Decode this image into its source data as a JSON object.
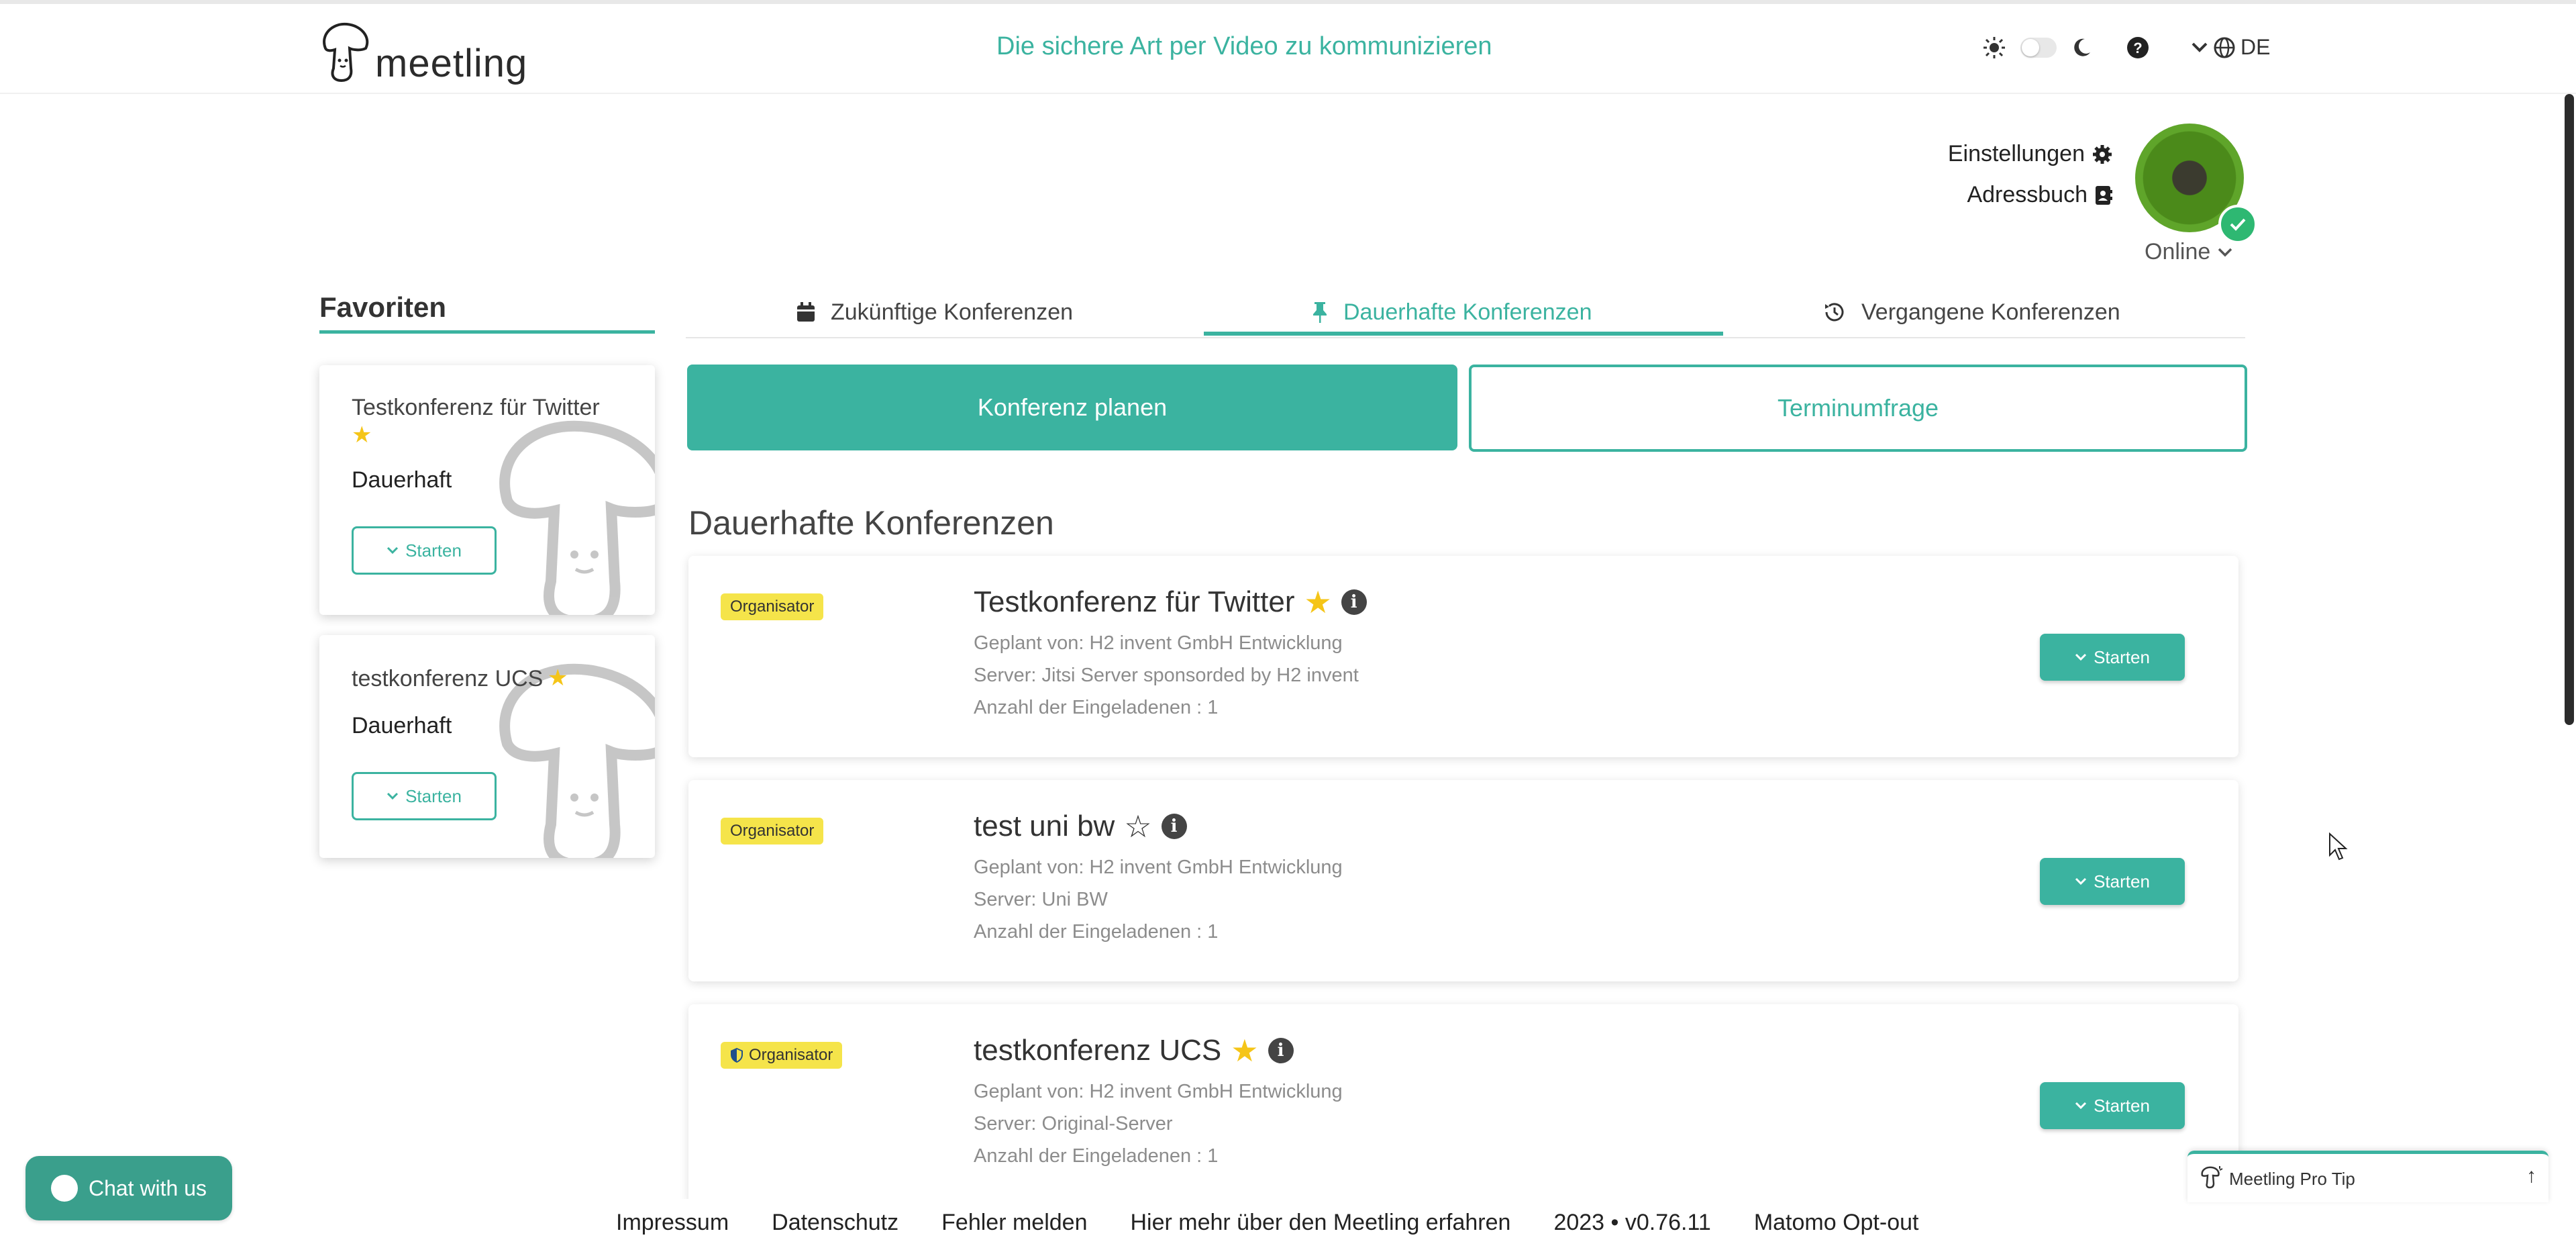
{
  "header": {
    "logo_text": "meetling",
    "tagline": "Die sichere Art per Video zu kommunizieren",
    "language": "DE"
  },
  "profile": {
    "settings_label": "Einstellungen",
    "addressbook_label": "Adressbuch",
    "status": "Online"
  },
  "favorites": {
    "title": "Favoriten",
    "items": [
      {
        "name": "Testkonferenz für Twitter",
        "type": "Dauerhaft",
        "start_label": "Starten"
      },
      {
        "name": "testkonferenz UCS",
        "type": "Dauerhaft",
        "start_label": "Starten"
      }
    ]
  },
  "tabs": [
    {
      "label": "Zukünftige Konferenzen",
      "icon": "calendar-icon"
    },
    {
      "label": "Dauerhafte Konferenzen",
      "icon": "pin-icon",
      "active": true
    },
    {
      "label": "Vergangene Konferenzen",
      "icon": "history-icon"
    }
  ],
  "actions": {
    "plan_label": "Konferenz planen",
    "poll_label": "Terminumfrage"
  },
  "section_title": "Dauerhafte Konferenzen",
  "conferences": [
    {
      "badge": "Organisator",
      "title": "Testkonferenz für Twitter",
      "starred": true,
      "planned_by": "Geplant von: H2 invent GmbH Entwicklung",
      "server": "Server: Jitsi Server sponsorded by H2 invent",
      "invited": "Anzahl der Eingeladenen : 1",
      "start_label": "Starten"
    },
    {
      "badge": "Organisator",
      "title": "test uni bw",
      "starred": false,
      "planned_by": "Geplant von: H2 invent GmbH Entwicklung",
      "server": "Server: Uni BW",
      "invited": "Anzahl der Eingeladenen : 1",
      "start_label": "Starten"
    },
    {
      "badge": "Organisator",
      "badge_icon": "shield-icon",
      "title": "testkonferenz UCS",
      "starred": true,
      "planned_by": "Geplant von: H2 invent GmbH Entwicklung",
      "server": "Server: Original-Server",
      "invited": "Anzahl der Eingeladenen : 1",
      "start_label": "Starten"
    }
  ],
  "footer": {
    "links": [
      "Impressum",
      "Datenschutz",
      "Fehler melden",
      "Hier mehr über den Meetling erfahren",
      "2023 • v0.76.11",
      "Matomo Opt-out"
    ]
  },
  "chat_label": "Chat with us",
  "protip_label": "Meetling Pro Tip",
  "colors": {
    "accent": "#3bb3a0",
    "badge": "#f5e44a",
    "star": "#f5c518",
    "online": "#2eb872"
  }
}
